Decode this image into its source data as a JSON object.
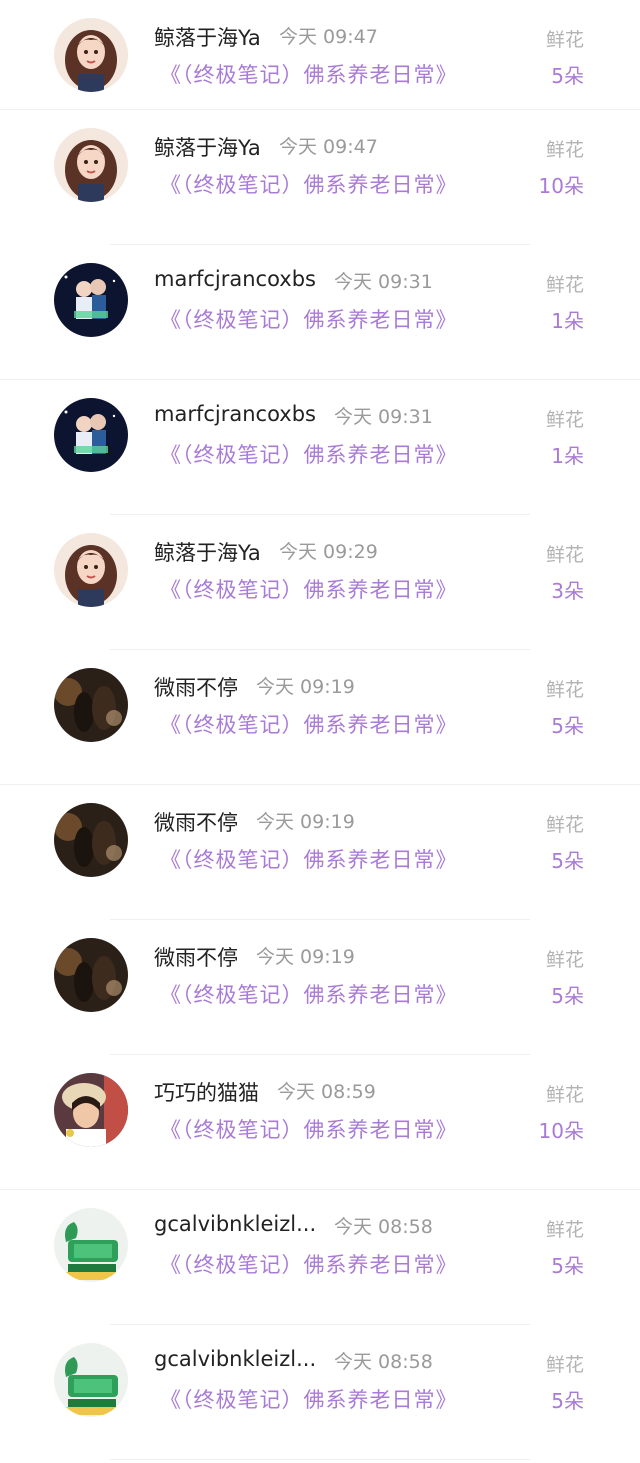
{
  "items": [
    {
      "user": "鲸落于海Ya",
      "time": "今天 09:47",
      "title": "《（终极笔记）佛系养老日常》",
      "gift": "鲜花",
      "count": "5朵",
      "avatar": "girl-avatar"
    },
    {
      "user": "鲸落于海Ya",
      "time": "今天 09:47",
      "title": "《（终极笔记）佛系养老日常》",
      "gift": "鲜花",
      "count": "10朵",
      "avatar": "girl-avatar"
    },
    {
      "user": "marfcjrancoxbs",
      "time": "今天 09:31",
      "title": "《（终极笔记）佛系养老日常》",
      "gift": "鲜花",
      "count": "1朵",
      "avatar": "couple-avatar"
    },
    {
      "user": "marfcjrancoxbs",
      "time": "今天 09:31",
      "title": "《（终极笔记）佛系养老日常》",
      "gift": "鲜花",
      "count": "1朵",
      "avatar": "couple-avatar"
    },
    {
      "user": "鲸落于海Ya",
      "time": "今天 09:29",
      "title": "《（终极笔记）佛系养老日常》",
      "gift": "鲜花",
      "count": "3朵",
      "avatar": "girl-avatar"
    },
    {
      "user": "微雨不停",
      "time": "今天 09:19",
      "title": "《（终极笔记）佛系养老日常》",
      "gift": "鲜花",
      "count": "5朵",
      "avatar": "dark-avatar"
    },
    {
      "user": "微雨不停",
      "time": "今天 09:19",
      "title": "《（终极笔记）佛系养老日常》",
      "gift": "鲜花",
      "count": "5朵",
      "avatar": "dark-avatar"
    },
    {
      "user": "微雨不停",
      "time": "今天 09:19",
      "title": "《（终极笔记）佛系养老日常》",
      "gift": "鲜花",
      "count": "5朵",
      "avatar": "dark-avatar"
    },
    {
      "user": "巧巧的猫猫",
      "time": "今天 08:59",
      "title": "《（终极笔记）佛系养老日常》",
      "gift": "鲜花",
      "count": "10朵",
      "avatar": "woman-avatar"
    },
    {
      "user": "gcalvibnkleizl...",
      "time": "今天 08:58",
      "title": "《（终极笔记）佛系养老日常》",
      "gift": "鲜花",
      "count": "5朵",
      "avatar": "jade-avatar"
    },
    {
      "user": "gcalvibnkleizl...",
      "time": "今天 08:58",
      "title": "《（终极笔记）佛系养老日常》",
      "gift": "鲜花",
      "count": "5朵",
      "avatar": "jade-avatar"
    }
  ],
  "colors": {
    "accent": "#a97bd6",
    "name": "#222222",
    "muted": "#9a9a9a",
    "gift": "#b3b3b3"
  }
}
